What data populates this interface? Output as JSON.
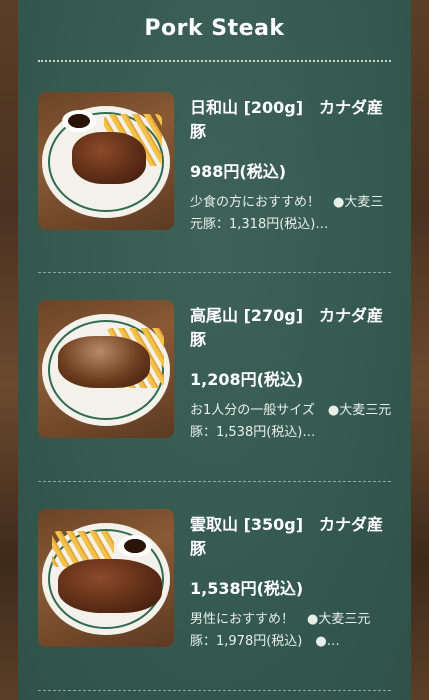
{
  "header": {
    "title": "Pork Steak"
  },
  "items": [
    {
      "name": "日和山 [200g]　カナダ産豚",
      "price": "988円(税込)",
      "description": "少食の方におすすめ！　●大麦三元豚：1,318円(税込)…"
    },
    {
      "name": "高尾山 [270g]　カナダ産豚",
      "price": "1,208円(税込)",
      "description": "お1人分の一般サイズ　●大麦三元豚：1,538円(税込)…"
    },
    {
      "name": "雲取山 [350g]　カナダ産豚",
      "price": "1,538円(税込)",
      "description": "男性におすすめ！　●大麦三元豚：1,978円(税込)　●…"
    }
  ],
  "colors": {
    "board": "#355a50",
    "text": "#ffffff",
    "wood": "#4a3220"
  }
}
